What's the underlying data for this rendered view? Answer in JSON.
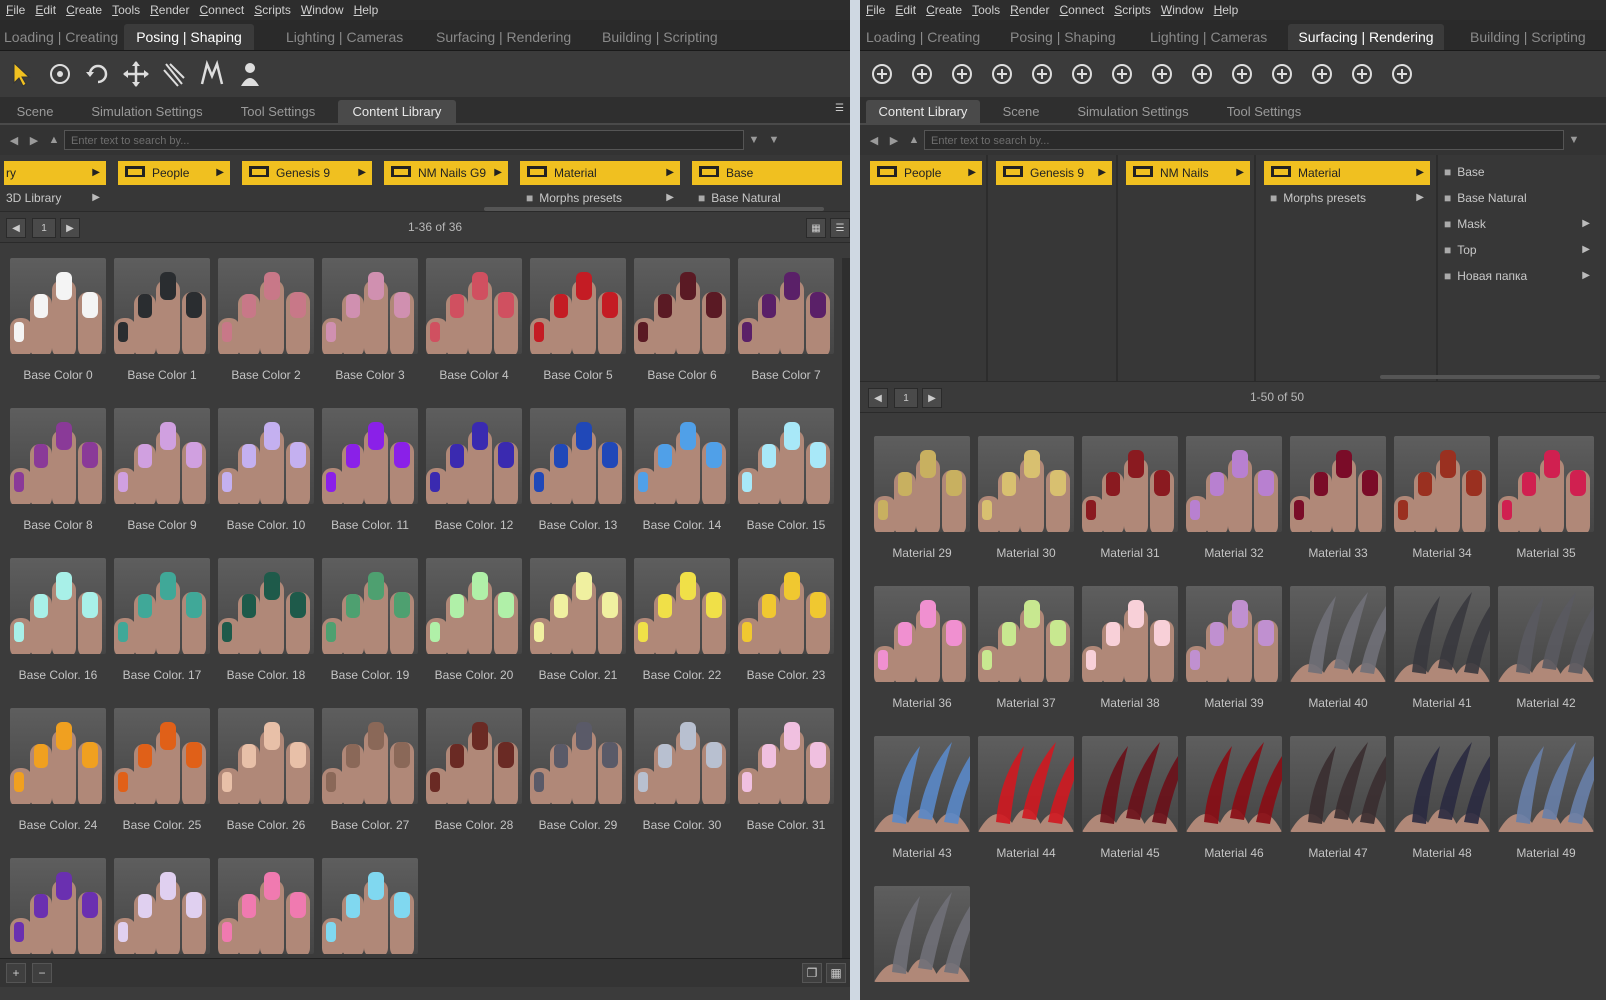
{
  "menu": [
    "File",
    "Edit",
    "Create",
    "Tools",
    "Render",
    "Connect",
    "Scripts",
    "Window",
    "Help"
  ],
  "left": {
    "tabs": [
      "Loading | Creating",
      "Posing | Shaping",
      "Lighting | Cameras",
      "Surfacing | Rendering",
      "Building | Scripting"
    ],
    "active_tab": "Posing | Shaping",
    "subtabs": [
      "Scene",
      "Simulation Settings",
      "Tool Settings",
      "Content Library"
    ],
    "active_subtab": "Content Library",
    "search_placeholder": "Enter text to search by...",
    "path": [
      "ry",
      "People",
      "Genesis 9",
      "NM Nails G9",
      "Material",
      "Base"
    ],
    "lib_root": "3D Library",
    "sub_items": [
      "Morphs presets",
      "Base Natural"
    ],
    "page": "1",
    "count": "1-36 of 36",
    "items": [
      {
        "label": "Base Color 0",
        "color": "#f4f4f4"
      },
      {
        "label": "Base Color 1",
        "color": "#2a2d30"
      },
      {
        "label": "Base Color 2",
        "color": "#c87888"
      },
      {
        "label": "Base Color 3",
        "color": "#d090b0"
      },
      {
        "label": "Base Color 4",
        "color": "#d05060"
      },
      {
        "label": "Base Color 5",
        "color": "#c41c24"
      },
      {
        "label": "Base Color 6",
        "color": "#5a1a24"
      },
      {
        "label": "Base Color 7",
        "color": "#5a2068"
      },
      {
        "label": "Base Color 8",
        "color": "#8a3a98"
      },
      {
        "label": "Base Color 9",
        "color": "#d0a0e0"
      },
      {
        "label": "Base Color. 10",
        "color": "#c4b0f0"
      },
      {
        "label": "Base Color. 11",
        "color": "#8a20e8"
      },
      {
        "label": "Base Color. 12",
        "color": "#3a2ab0"
      },
      {
        "label": "Base Color. 13",
        "color": "#2048b8"
      },
      {
        "label": "Base Color. 14",
        "color": "#50a0e8"
      },
      {
        "label": "Base Color. 15",
        "color": "#a8e8f8"
      },
      {
        "label": "Base Color. 16",
        "color": "#a8f0e8"
      },
      {
        "label": "Base Color. 17",
        "color": "#40a898"
      },
      {
        "label": "Base Color. 18",
        "color": "#1e5a4a"
      },
      {
        "label": "Base Color. 19",
        "color": "#4ea070"
      },
      {
        "label": "Base Color. 20",
        "color": "#b0f0a8"
      },
      {
        "label": "Base Color. 21",
        "color": "#f0f0a0"
      },
      {
        "label": "Base Color. 22",
        "color": "#f0e048"
      },
      {
        "label": "Base Color. 23",
        "color": "#f0c830"
      },
      {
        "label": "Base Color. 24",
        "color": "#f0a020"
      },
      {
        "label": "Base Color. 25",
        "color": "#e06018"
      },
      {
        "label": "Base Color. 26",
        "color": "#e8c0a8"
      },
      {
        "label": "Base Color. 27",
        "color": "#8a6858"
      },
      {
        "label": "Base Color. 28",
        "color": "#6a2a24"
      },
      {
        "label": "Base Color. 29",
        "color": "#5a5a68"
      },
      {
        "label": "Base Color. 30",
        "color": "#b8c0d0"
      },
      {
        "label": "Base Color. 31",
        "color": "#f0c0e0"
      },
      {
        "label": "",
        "color": "#6a30b0"
      },
      {
        "label": "",
        "color": "#e0d0f0"
      },
      {
        "label": "",
        "color": "#f07ab0"
      },
      {
        "label": "",
        "color": "#80d8f0"
      }
    ]
  },
  "right": {
    "tabs": [
      "Loading | Creating",
      "Posing | Shaping",
      "Lighting | Cameras",
      "Surfacing | Rendering",
      "Building | Scripting"
    ],
    "active_tab": "Surfacing | Rendering",
    "subtabs": [
      "Content Library",
      "Scene",
      "Simulation Settings",
      "Tool Settings"
    ],
    "active_subtab": "Content Library",
    "search_placeholder": "Enter text to search by...",
    "path": [
      "People",
      "Genesis 9",
      "NM Nails",
      "Material"
    ],
    "sub_items": [
      "Morphs presets"
    ],
    "material_children": [
      "Base",
      "Base Natural",
      "Mask",
      "Top",
      "Новая папка"
    ],
    "page": "1",
    "count": "1-50 of 50",
    "items": [
      {
        "label": "Material 29",
        "color": "#c8b060",
        "style": "short"
      },
      {
        "label": "Material 30",
        "color": "#d8c070",
        "style": "short"
      },
      {
        "label": "Material 31",
        "color": "#8a1a20",
        "style": "short"
      },
      {
        "label": "Material 32",
        "color": "#b880d0",
        "style": "short"
      },
      {
        "label": "Material 33",
        "color": "#7a0c28",
        "style": "short"
      },
      {
        "label": "Material 34",
        "color": "#9a3020",
        "style": "short"
      },
      {
        "label": "Material 35",
        "color": "#d02050",
        "style": "short"
      },
      {
        "label": "Material 36",
        "color": "#f090d0",
        "style": "short"
      },
      {
        "label": "Material 37",
        "color": "#c8e890",
        "style": "short"
      },
      {
        "label": "Material 38",
        "color": "#f8d0d8",
        "style": "short"
      },
      {
        "label": "Material 39",
        "color": "#c090d0",
        "style": "short"
      },
      {
        "label": "Material 40",
        "color": "#707078",
        "style": "long"
      },
      {
        "label": "Material 41",
        "color": "#38383e",
        "style": "long"
      },
      {
        "label": "Material 42",
        "color": "#5a5a60",
        "style": "long"
      },
      {
        "label": "Material 43",
        "color": "#5a88c8",
        "style": "long"
      },
      {
        "label": "Material 44",
        "color": "#d01820",
        "style": "long"
      },
      {
        "label": "Material 45",
        "color": "#6a1018",
        "style": "long"
      },
      {
        "label": "Material 46",
        "color": "#8a0c14",
        "style": "long"
      },
      {
        "label": "Material 47",
        "color": "#3a2e30",
        "style": "long"
      },
      {
        "label": "Material 48",
        "color": "#2a2a40",
        "style": "long"
      },
      {
        "label": "Material 49",
        "color": "#6880a8",
        "style": "long"
      },
      {
        "label": "",
        "color": "#707078",
        "style": "long"
      }
    ]
  }
}
